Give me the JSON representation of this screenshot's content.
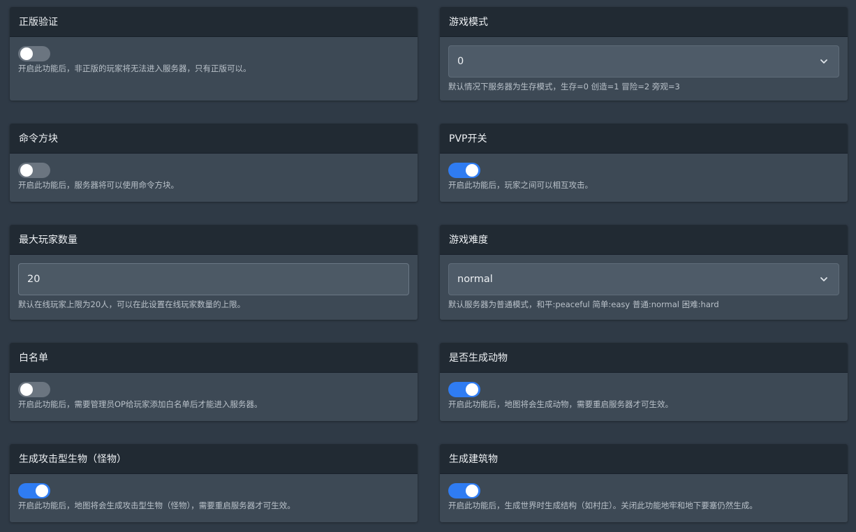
{
  "cards": {
    "online_mode": {
      "title": "正版验证",
      "enabled": false,
      "help": "开启此功能后，非正版的玩家将无法进入服务器，只有正版可以。"
    },
    "game_mode": {
      "title": "游戏模式",
      "value": "0",
      "help": "默认情况下服务器为生存模式，生存=0 创造=1 冒险=2 旁观=3"
    },
    "command_block": {
      "title": "命令方块",
      "enabled": false,
      "help": "开启此功能后，服务器将可以使用命令方块。"
    },
    "pvp": {
      "title": "PVP开关",
      "enabled": true,
      "help": "开启此功能后，玩家之间可以相互攻击。"
    },
    "max_players": {
      "title": "最大玩家数量",
      "value": "20",
      "help": "默认在线玩家上限为20人，可以在此设置在线玩家数量的上限。"
    },
    "difficulty": {
      "title": "游戏难度",
      "value": "normal",
      "help": "默认服务器为普通模式，和平:peaceful 简单:easy 普通:normal 困难:hard"
    },
    "whitelist": {
      "title": "白名单",
      "enabled": false,
      "help": "开启此功能后，需要管理员OP给玩家添加白名单后才能进入服务器。"
    },
    "spawn_animals": {
      "title": "是否生成动物",
      "enabled": true,
      "help": "开启此功能后，地图将会生成动物，需要重启服务器才可生效。"
    },
    "spawn_monsters": {
      "title": "生成攻击型生物（怪物）",
      "enabled": true,
      "help": "开启此功能后，地图将会生成攻击型生物（怪物），需要重启服务器才可生效。"
    },
    "generate_structures": {
      "title": "生成建筑物",
      "enabled": true,
      "help": "开启此功能后，生成世界时生成结构（如村庄）。关闭此功能地牢和地下要塞仍然生成。"
    }
  },
  "icons": {
    "select_arrow": "chevron-down-icon"
  },
  "colors": {
    "toggle_on": "#2f7cf2",
    "toggle_off": "#6b7580",
    "card_header": "#212a33",
    "card_body": "#3d4955",
    "background": "#2f3a46"
  }
}
